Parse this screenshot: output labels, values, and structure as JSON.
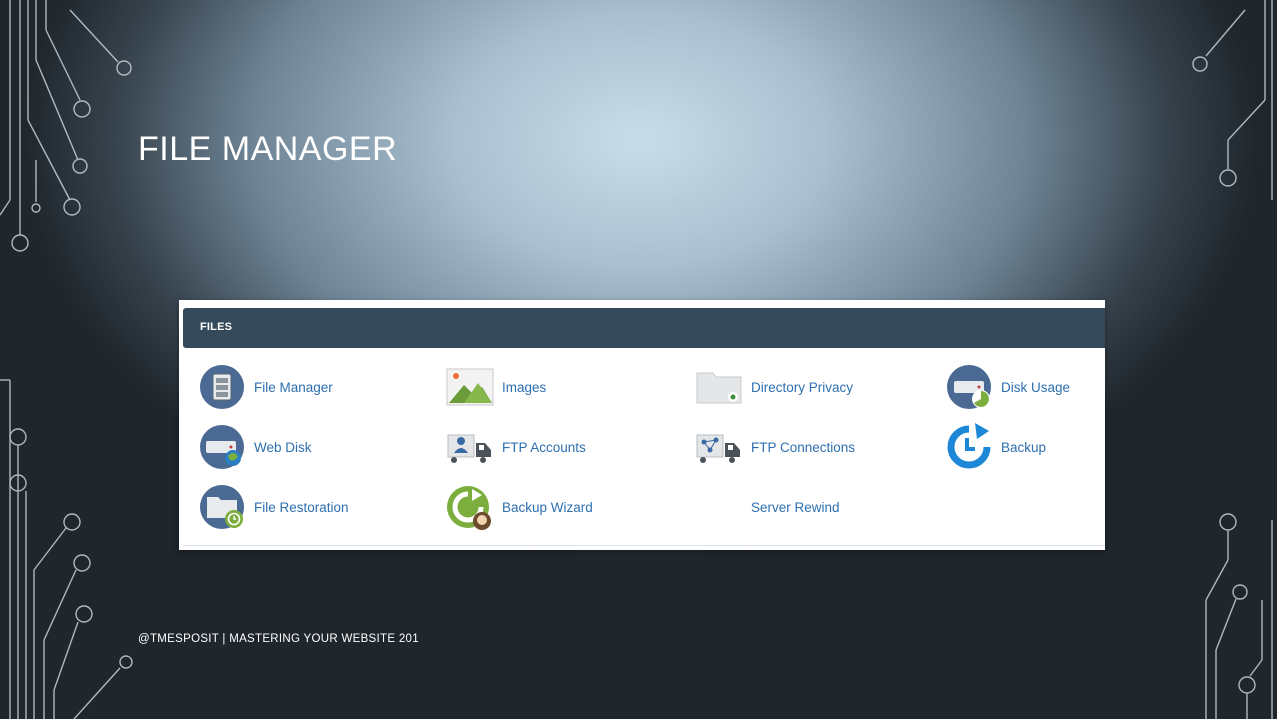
{
  "slide": {
    "title": "FILE MANAGER",
    "footer": "@TMESPOSIT | MASTERING YOUR WEBSITE 201"
  },
  "panel": {
    "header": "FILES",
    "items": [
      {
        "label": "File Manager",
        "icon": "file-manager-icon"
      },
      {
        "label": "Images",
        "icon": "images-icon"
      },
      {
        "label": "Directory Privacy",
        "icon": "directory-privacy-icon"
      },
      {
        "label": "Disk Usage",
        "icon": "disk-usage-icon"
      },
      {
        "label": "Web Disk",
        "icon": "web-disk-icon"
      },
      {
        "label": "FTP Accounts",
        "icon": "ftp-accounts-icon"
      },
      {
        "label": "FTP Connections",
        "icon": "ftp-connections-icon"
      },
      {
        "label": "Backup",
        "icon": "backup-icon"
      },
      {
        "label": "File Restoration",
        "icon": "file-restoration-icon"
      },
      {
        "label": "Backup Wizard",
        "icon": "backup-wizard-icon"
      },
      {
        "label": "Server Rewind",
        "icon": ""
      }
    ]
  },
  "colors": {
    "header_bg": "#34495a",
    "link": "#2d6fb0",
    "icon_blue": "#4a6a94",
    "icon_green": "#7cae3e",
    "backup_blue": "#1e88d8"
  }
}
